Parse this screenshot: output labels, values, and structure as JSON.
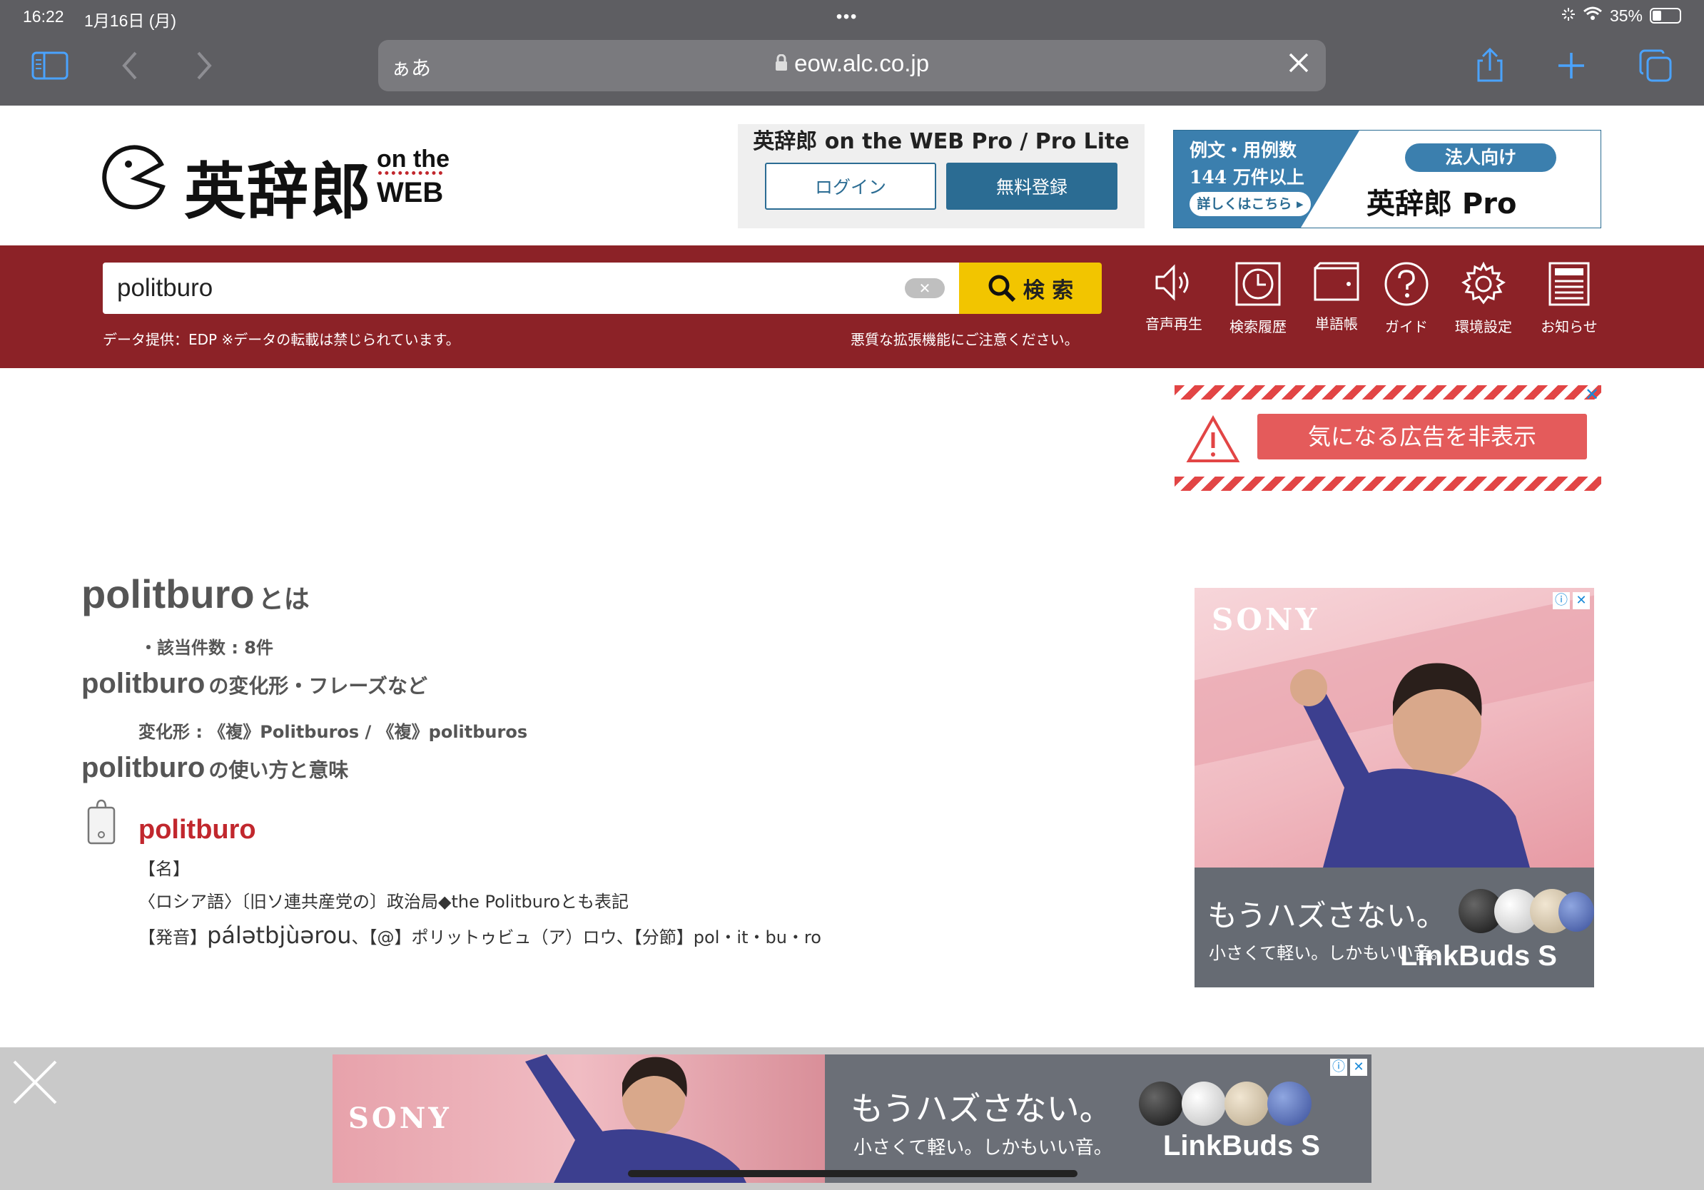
{
  "status": {
    "time": "16:22",
    "date": "1月16日 (月)",
    "dots": "•••",
    "battery": "35%"
  },
  "browser": {
    "aa_label": "ぁあ",
    "url": "eow.alc.co.jp",
    "icons": [
      "sidebar-icon",
      "back-icon",
      "forward-icon",
      "share-icon",
      "new-tab-icon",
      "tabs-icon"
    ]
  },
  "header": {
    "logo_text": "英辞郎",
    "logo_onthe": "on the",
    "logo_web": "WEB",
    "pro_title": "英辞郎 on the WEB Pro / Pro Lite",
    "login_label": "ログイン",
    "register_label": "無料登録",
    "banner": {
      "line1": "例文・用例数",
      "line2": "144 万件以上",
      "more": "詳しくはこちら ▸",
      "tag": "法人向け",
      "brand": "英辞郎 Pro"
    }
  },
  "search": {
    "value": "politburo",
    "button_label": "検 索",
    "note_left": "データ提供：EDP ※データの転載は禁じられています。",
    "note_right": "悪質な拡張機能にご注意ください。",
    "tools": [
      {
        "label": "音声再生",
        "icon": "speaker-icon"
      },
      {
        "label": "検索履歴",
        "icon": "history-icon"
      },
      {
        "label": "単語帳",
        "icon": "wordbook-icon"
      },
      {
        "label": "ガイド",
        "icon": "help-icon"
      },
      {
        "label": "環境設定",
        "icon": "gear-icon"
      },
      {
        "label": "お知らせ",
        "icon": "news-icon"
      }
    ]
  },
  "ad_notice": {
    "label": "気になる広告を非表示",
    "close": "✕"
  },
  "result": {
    "word": "politburo",
    "title_suffix": "とは",
    "count": "・該当件数 : 8件",
    "section1_suffix": "の変化形・フレーズなど",
    "forms": "変化形 : 《複》Politburos / 《複》politburos",
    "section2_suffix": "の使い方と意味",
    "entry": {
      "headword": "politburo",
      "pos": "【名】",
      "definition": "〈ロシア語〉〔旧ソ連共産党の〕政治局◆the Politburoとも表記",
      "pron_label": "【発音】",
      "ipa": "pálətbjùərou",
      "pron_rest": "、【@】ポリットゥビュ（ア）ロウ、【分節】pol・it・bu・ro"
    }
  },
  "side_ad": {
    "brand": "SONY",
    "copy1": "もうハズさない。",
    "copy2": "小さくて軽い。しかもいい音。",
    "product": "LinkBuds S",
    "info": "ⓘ",
    "close": "✕"
  },
  "bottom_ad": {
    "brand": "SONY",
    "copy1": "もうハズさない。",
    "copy2": "小さくて軽い。しかもいい音。",
    "product": "LinkBuds S",
    "info": "ⓘ",
    "close": "✕"
  }
}
